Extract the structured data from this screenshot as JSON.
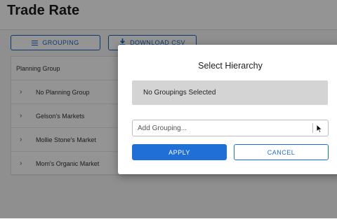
{
  "page": {
    "title": "Trade Rate"
  },
  "toolbar": {
    "grouping_label": "GROUPING",
    "grouping_icon": "hamburger-icon",
    "download_label": "DOWNLOAD CSV",
    "download_icon": "download-icon"
  },
  "table": {
    "header": "Planning Group",
    "rows": [
      {
        "label": "No Planning Group"
      },
      {
        "label": "Gelson's Markets"
      },
      {
        "label": "Mollie Stone's Market"
      },
      {
        "label": "Mom's Organic Market"
      }
    ]
  },
  "dialog": {
    "title": "Select Hierarchy",
    "selected_text": "No Groupings Selected",
    "input_placeholder": "Add Grouping...",
    "apply_label": "APPLY",
    "cancel_label": "CANCEL"
  },
  "colors": {
    "accent": "#1f6fd6",
    "overlay": "rgba(0,0,0,0.42)",
    "selected_box": "#d4d4d4"
  }
}
